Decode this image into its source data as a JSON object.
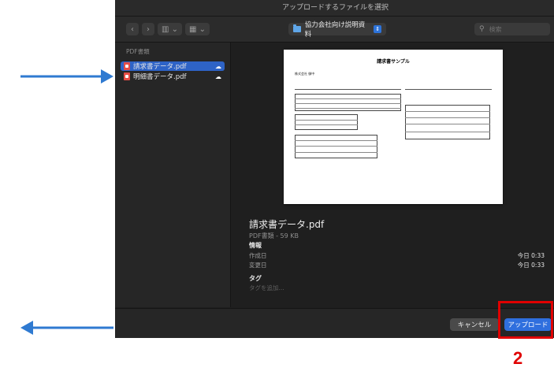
{
  "dialog": {
    "title": "アップロードするファイルを選択",
    "location": "協力会社向け説明資料",
    "search_placeholder": "検索",
    "view_icon": "columns-view-icon",
    "group_icon": "group-icon"
  },
  "sidebar": {
    "header": "PDF書類",
    "files": [
      {
        "name": "請求書データ.pdf",
        "selected": true
      },
      {
        "name": "明細書データ.pdf",
        "selected": false
      }
    ]
  },
  "preview": {
    "doc_title": "請求書サンプル",
    "doc_to": "株式会社 御中"
  },
  "info": {
    "file_name": "請求書データ.pdf",
    "kind": "PDF書類 - 59 KB",
    "section_info": "情報",
    "created_label": "作成日",
    "created_value": "今日 0:33",
    "modified_label": "変更日",
    "modified_value": "今日 0:33",
    "section_tags": "タグ",
    "tag_placeholder": "タグを追加..."
  },
  "footer": {
    "cancel": "キャンセル",
    "upload": "アップロード"
  },
  "annotation": {
    "step": "2",
    "color": "#e00000",
    "arrow_color": "#2f7ad1"
  }
}
